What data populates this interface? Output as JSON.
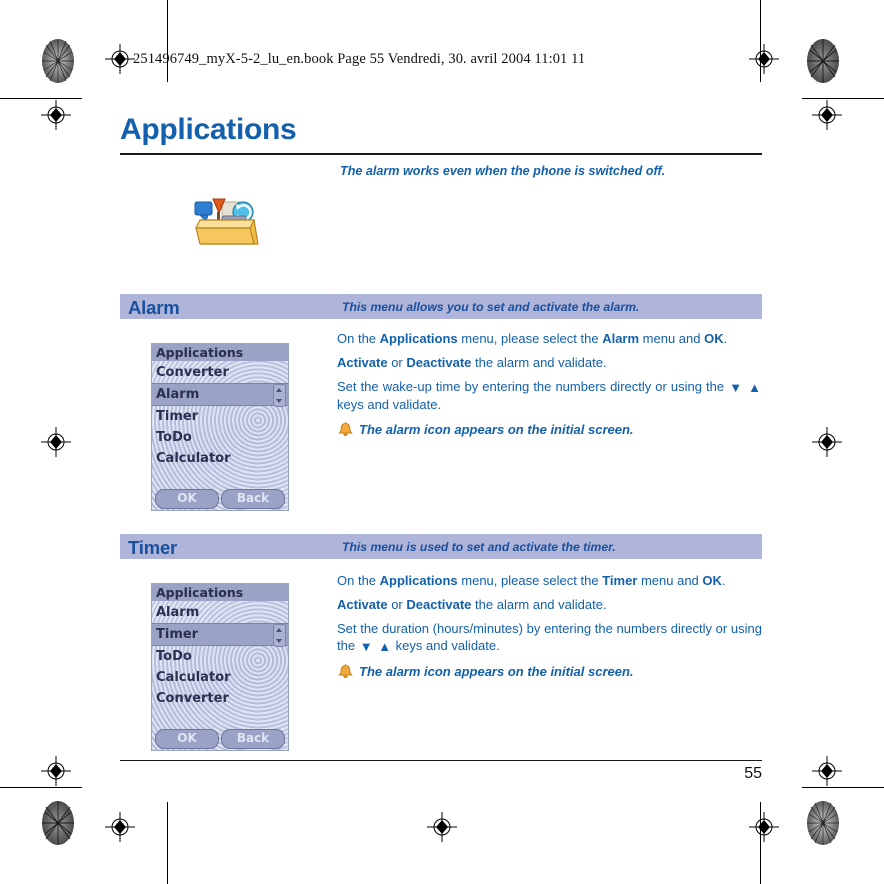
{
  "print_marks": {
    "registration_icon": "registration-target-icon",
    "starburst_icon": "star-target-icon"
  },
  "header": {
    "file_info": "251496749_myX-5-2_lu_en.book  Page 55  Vendredi, 30. avril 2004  11:01 11"
  },
  "page": {
    "title": "Applications",
    "intro_note": "The alarm works even when the phone is switched off.",
    "chapter_icon": "toolbox-icon",
    "page_number": "55"
  },
  "sections": [
    {
      "name": "Alarm",
      "description": "This menu allows you to set and activate the alarm.",
      "screenshot": {
        "title": "Applications",
        "items": [
          {
            "label": "Converter",
            "selected": false
          },
          {
            "label": "Alarm",
            "selected": true
          },
          {
            "label": "Timer",
            "selected": false
          },
          {
            "label": "ToDo",
            "selected": false
          },
          {
            "label": "Calculator",
            "selected": false
          }
        ],
        "softkey_left": "OK",
        "softkey_right": "Back"
      },
      "paragraphs": [
        {
          "parts": [
            {
              "t": "On the ",
              "b": false
            },
            {
              "t": "Applications",
              "b": true
            },
            {
              "t": " menu, please select the ",
              "b": false
            },
            {
              "t": "Alarm",
              "b": true
            },
            {
              "t": " menu and ",
              "b": false
            },
            {
              "t": "OK",
              "b": true
            },
            {
              "t": ".",
              "b": false
            }
          ]
        },
        {
          "parts": [
            {
              "t": "Activate",
              "b": true
            },
            {
              "t": " or ",
              "b": false
            },
            {
              "t": "Deactivate",
              "b": true
            },
            {
              "t": " the alarm and validate.",
              "b": false
            }
          ]
        },
        {
          "parts": [
            {
              "t": "Set the wake-up time by entering the numbers directly or using the ",
              "b": false
            },
            {
              "t": "▼",
              "b": false,
              "arrow": true
            },
            {
              "t": " ",
              "b": false
            },
            {
              "t": "▲",
              "b": false,
              "arrow": true
            },
            {
              "t": " keys and validate.",
              "b": false
            }
          ]
        }
      ],
      "note": "The alarm icon appears on the initial screen.",
      "note_icon": "bell-icon"
    },
    {
      "name": "Timer",
      "description": "This menu is used to set and activate the timer.",
      "screenshot": {
        "title": "Applications",
        "items": [
          {
            "label": "Alarm",
            "selected": false
          },
          {
            "label": "Timer",
            "selected": true
          },
          {
            "label": "ToDo",
            "selected": false
          },
          {
            "label": "Calculator",
            "selected": false
          },
          {
            "label": "Converter",
            "selected": false
          }
        ],
        "softkey_left": "OK",
        "softkey_right": "Back"
      },
      "paragraphs": [
        {
          "parts": [
            {
              "t": "On the ",
              "b": false
            },
            {
              "t": "Applications",
              "b": true
            },
            {
              "t": " menu, please select the ",
              "b": false
            },
            {
              "t": "Timer",
              "b": true
            },
            {
              "t": " menu and ",
              "b": false
            },
            {
              "t": "OK",
              "b": true
            },
            {
              "t": ".",
              "b": false
            }
          ]
        },
        {
          "parts": [
            {
              "t": "Activate",
              "b": true
            },
            {
              "t": " or ",
              "b": false
            },
            {
              "t": "Deactivate",
              "b": true
            },
            {
              "t": " the alarm and validate.",
              "b": false
            }
          ]
        },
        {
          "parts": [
            {
              "t": "Set the duration (hours/minutes) by entering the numbers directly or using the ",
              "b": false
            },
            {
              "t": "▼",
              "b": false,
              "arrow": true
            },
            {
              "t": " ",
              "b": false
            },
            {
              "t": "▲",
              "b": false,
              "arrow": true
            },
            {
              "t": " keys and validate.",
              "b": false
            }
          ]
        }
      ],
      "note": "The alarm icon appears on the initial screen.",
      "note_icon": "bell-icon"
    }
  ],
  "colors": {
    "brand_blue": "#1360ac",
    "section_bar": "#aeb4da",
    "section_text": "#1a4f9c",
    "bell": "#f0a33c"
  }
}
